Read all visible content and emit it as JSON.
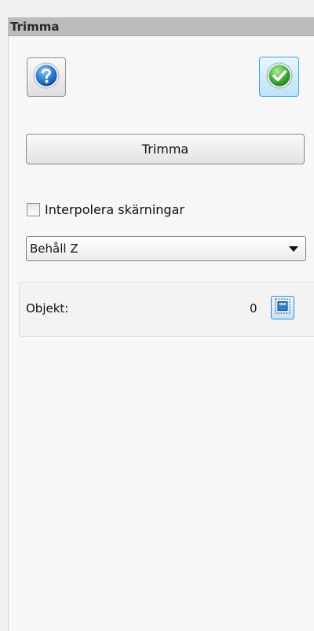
{
  "panel": {
    "title": "Trimma"
  },
  "toolbar": {
    "help_icon": "question-mark-icon",
    "ok_icon": "green-check-icon"
  },
  "actions": {
    "trim_label": "Trimma"
  },
  "options": {
    "interpolate_label": "Interpolera skärningar",
    "interpolate_checked": false,
    "z_mode_value": "Behåll Z"
  },
  "objects": {
    "label": "Objekt:",
    "count": "0",
    "select_icon": "select-objects-icon"
  },
  "colors": {
    "title_bar": "#bcbcbc",
    "ok_button_highlight": "#3ea6e6",
    "help_blue": "#2f7fd4",
    "check_green": "#45b43a"
  }
}
